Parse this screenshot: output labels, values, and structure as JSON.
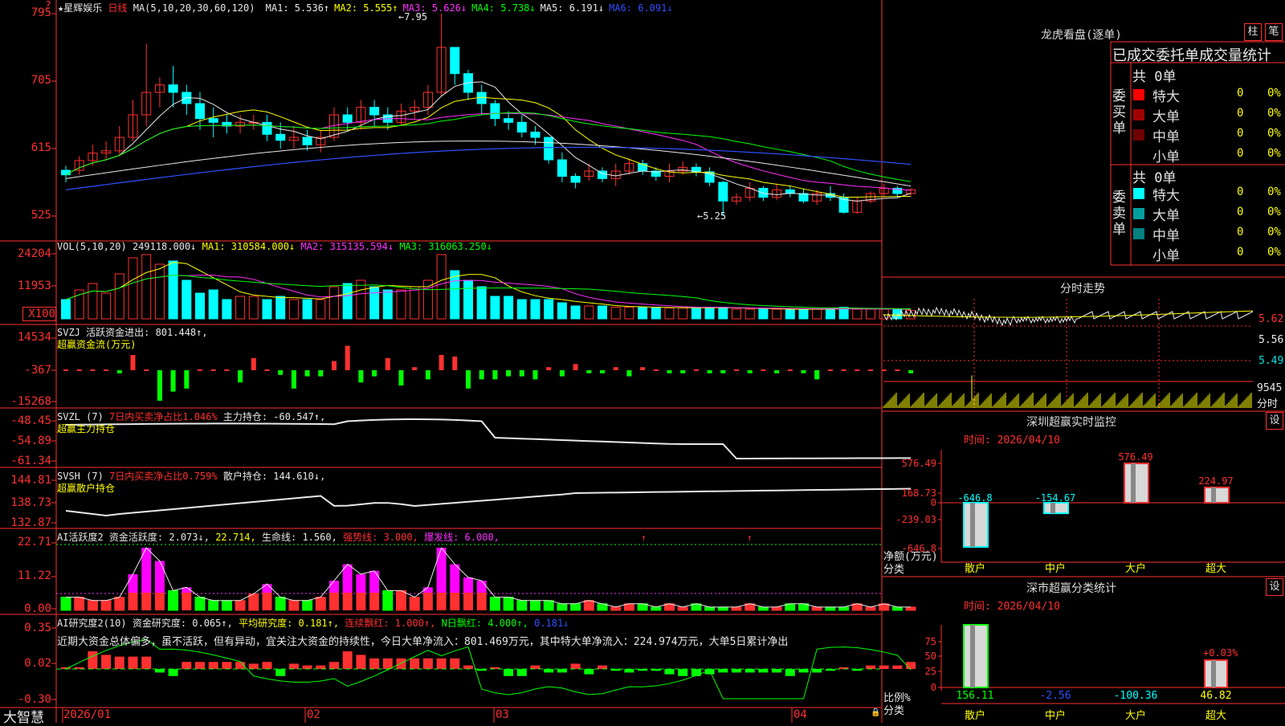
{
  "header": {
    "stock_name": "★星辉娱乐",
    "period": "日线",
    "ma_params": "MA(5,10,20,30,60,120)",
    "ma": [
      {
        "label": "MA1:",
        "value": "5.536↑",
        "color": "#e8e8e8"
      },
      {
        "label": "MA2:",
        "value": "5.555↑",
        "color": "#ffff00"
      },
      {
        "label": "MA3:",
        "value": "5.626↓",
        "color": "#ff30ff"
      },
      {
        "label": "MA4:",
        "value": "5.738↓",
        "color": "#00ff00"
      },
      {
        "label": "MA5:",
        "value": "6.191↓",
        "color": "#e8e8e8"
      },
      {
        "label": "MA6:",
        "value": "6.091↓",
        "color": "#3050ff"
      }
    ],
    "high_mark": "7.95",
    "low_mark": "5.25",
    "corner_mark": "?"
  },
  "price_axis": [
    "795",
    "705",
    "615",
    "525"
  ],
  "vol": {
    "title": "VOL(5,10,20)",
    "value": "249118.000↓",
    "ma1": "MA1: 310584.000↓",
    "ma2": "MA2: 315135.594↓",
    "ma3": "MA3: 316063.250↓",
    "axis": [
      "24204",
      "11953",
      "X100"
    ]
  },
  "svzj": {
    "line1": "SVZJ  活跃资金进出: 801.448↑,",
    "line2": "超赢资金流(万元)",
    "axis": [
      "14534",
      "-367",
      "-15268"
    ]
  },
  "svzl": {
    "title": "SVZL (7)",
    "ratio": "7日内买卖净占比1.046%",
    "hold": "主力持仓: -60.547↑,",
    "line2": "超赢主力持仓",
    "axis": [
      "-48.45",
      "-54.89",
      "-61.34"
    ]
  },
  "svsh": {
    "title": "SVSH (7)",
    "ratio": "7日内买卖净占比0.759%",
    "hold": "散户持仓: 144.610↓,",
    "line2": "超赢散户持仓",
    "axis": [
      "144.81",
      "138.73",
      "132.87"
    ]
  },
  "ai_active": {
    "title": "AI活跃度2",
    "active": "资金活跃度: 2.073↓,",
    "v2": "22.714,",
    "life": "生命线: 1.560,",
    "strong": "强势线: 3.000,",
    "burst": "爆发线: 6.000,",
    "axis": [
      "22.71",
      "11.22",
      "0.00"
    ]
  },
  "ai_research": {
    "title": "AI研究度2(10)",
    "research": "资金研究度: 0.065↑,",
    "avg": "平均研究度: 0.181↑,",
    "cont": "连续飘红: 1.000↑,",
    "nday": "N日飘红: 4.000↑,",
    "v5": "0.181↓",
    "comment": "近期大资金总体偏多，虽不活跃，但有异动，宜关注大资金的持续性，今日大单净流入：801.469万元，其中特大单净流入：224.974万元，大单5日累计净出",
    "axis": [
      "0.35",
      "0.02",
      "-0.30"
    ]
  },
  "bottom": {
    "brand": "大智慧",
    "months": [
      "2026/01",
      "02",
      "03",
      "04"
    ]
  },
  "longhu": {
    "title": "龙虎看盘(逐单)",
    "btn1": "柱",
    "btn2": "笔",
    "heading": "已成交委托单成交量统计",
    "buy_side": "委买单",
    "sell_side": "委卖单",
    "buy_total": "共 0单",
    "sell_total": "共 0单",
    "buy_rows": [
      {
        "name": "特大",
        "count": "0",
        "pct": "0%",
        "color": "#ff0000"
      },
      {
        "name": "大单",
        "count": "0",
        "pct": "0%",
        "color": "#a00000"
      },
      {
        "name": "中单",
        "count": "0",
        "pct": "0%",
        "color": "#700000"
      },
      {
        "name": "小单",
        "count": "0",
        "pct": "0%",
        "color": ""
      }
    ],
    "sell_rows": [
      {
        "name": "特大",
        "count": "0",
        "pct": "0%",
        "color": "#00ffff"
      },
      {
        "name": "大单",
        "count": "0",
        "pct": "0%",
        "color": "#00a0a0"
      },
      {
        "name": "中单",
        "count": "0",
        "pct": "0%",
        "color": "#008080"
      },
      {
        "name": "小单",
        "count": "0",
        "pct": "0%",
        "color": ""
      }
    ]
  },
  "fenshi": {
    "title": "分时走势",
    "axis": [
      "5.62",
      "5.56",
      "5.49"
    ],
    "vol_axis": [
      "9545",
      "分时"
    ]
  },
  "monitor": {
    "title": "深圳超赢实时监控",
    "btn": "设",
    "time": "时间: 2026/04/10",
    "axis": [
      "576.49",
      "168.73",
      "0",
      "-239.03",
      "-646.8"
    ],
    "ylabel": "净额(万元)",
    "xlabel": "分类",
    "categories": [
      "散户",
      "中户",
      "大户",
      "超大"
    ],
    "values": [
      -646.8,
      -154.67,
      576.49,
      224.97
    ],
    "value_labels": [
      "-646.8",
      "-154.67",
      "576.49",
      "224.97"
    ]
  },
  "classify": {
    "title": "深市超赢分类统计",
    "btn": "设",
    "time": "时间: 2026/04/10",
    "axis": [
      "75",
      "50",
      "25",
      "0"
    ],
    "ylabel": "比例%",
    "xlabel": "分类",
    "categories": [
      "散户",
      "中户",
      "大户",
      "超大"
    ],
    "values": [
      156.11,
      -2.56,
      -100.36,
      46.82
    ],
    "value_labels": [
      "156.11",
      "-2.56",
      "-100.36",
      "46.82"
    ],
    "pct_label": "+0.03%"
  },
  "chart_data": {
    "type": "candlestick",
    "title": "星辉娱乐 日线",
    "ylim": [
      5.0,
      8.0
    ],
    "candles": [
      [
        5.86,
        5.8,
        5.92,
        5.7
      ],
      [
        5.86,
        5.99,
        6.05,
        5.8
      ],
      [
        5.99,
        6.09,
        6.2,
        5.92
      ],
      [
        6.09,
        6.12,
        6.25,
        6.0
      ],
      [
        6.12,
        6.3,
        6.45,
        6.05
      ],
      [
        6.3,
        6.6,
        6.8,
        6.25
      ],
      [
        6.6,
        6.9,
        7.55,
        6.45
      ],
      [
        6.9,
        7.0,
        7.1,
        6.7
      ],
      [
        7.0,
        6.9,
        7.25,
        6.7
      ],
      [
        6.9,
        6.75,
        7.0,
        6.6
      ],
      [
        6.75,
        6.55,
        6.9,
        6.4
      ],
      [
        6.55,
        6.5,
        6.7,
        6.3
      ],
      [
        6.5,
        6.45,
        6.6,
        6.35
      ],
      [
        6.45,
        6.5,
        6.6,
        6.35
      ],
      [
        6.5,
        6.5,
        6.6,
        6.4
      ],
      [
        6.5,
        6.34,
        6.6,
        6.25
      ],
      [
        6.34,
        6.26,
        6.5,
        6.15
      ],
      [
        6.26,
        6.3,
        6.45,
        6.15
      ],
      [
        6.3,
        6.2,
        6.4,
        6.12
      ],
      [
        6.2,
        6.3,
        6.4,
        6.1
      ],
      [
        6.3,
        6.6,
        6.7,
        6.25
      ],
      [
        6.6,
        6.5,
        6.7,
        6.4
      ],
      [
        6.5,
        6.7,
        6.8,
        6.4
      ],
      [
        6.7,
        6.6,
        6.8,
        6.45
      ],
      [
        6.6,
        6.5,
        6.7,
        6.4
      ],
      [
        6.5,
        6.65,
        6.75,
        6.45
      ],
      [
        6.65,
        6.7,
        6.8,
        6.55
      ],
      [
        6.7,
        6.9,
        7.0,
        6.6
      ],
      [
        6.9,
        7.5,
        7.95,
        6.85
      ],
      [
        7.5,
        7.15,
        7.5,
        7.0
      ],
      [
        7.15,
        6.9,
        7.2,
        6.8
      ],
      [
        6.9,
        6.75,
        7.0,
        6.6
      ],
      [
        6.75,
        6.55,
        6.8,
        6.45
      ],
      [
        6.55,
        6.5,
        6.65,
        6.4
      ],
      [
        6.5,
        6.37,
        6.6,
        6.3
      ],
      [
        6.37,
        6.3,
        6.45,
        6.2
      ],
      [
        6.3,
        6.0,
        6.3,
        5.95
      ],
      [
        6.0,
        5.78,
        6.1,
        5.7
      ],
      [
        5.78,
        5.7,
        5.82,
        5.62
      ],
      [
        5.78,
        5.85,
        5.95,
        5.72
      ],
      [
        5.85,
        5.75,
        5.9,
        5.7
      ],
      [
        5.75,
        5.85,
        5.95,
        5.65
      ],
      [
        5.85,
        5.95,
        6.02,
        5.8
      ],
      [
        5.95,
        5.85,
        6.0,
        5.8
      ],
      [
        5.85,
        5.78,
        5.9,
        5.72
      ],
      [
        5.78,
        5.85,
        5.95,
        5.7
      ],
      [
        5.85,
        5.9,
        5.98,
        5.8
      ],
      [
        5.9,
        5.84,
        5.95,
        5.78
      ],
      [
        5.84,
        5.7,
        5.9,
        5.65
      ],
      [
        5.7,
        5.45,
        5.72,
        5.25
      ],
      [
        5.45,
        5.5,
        5.55,
        5.4
      ],
      [
        5.5,
        5.62,
        5.7,
        5.45
      ],
      [
        5.62,
        5.5,
        5.65,
        5.45
      ],
      [
        5.5,
        5.6,
        5.68,
        5.46
      ],
      [
        5.6,
        5.55,
        5.65,
        5.5
      ],
      [
        5.55,
        5.45,
        5.62,
        5.42
      ],
      [
        5.45,
        5.55,
        5.6,
        5.4
      ],
      [
        5.55,
        5.5,
        5.65,
        5.45
      ],
      [
        5.5,
        5.3,
        5.55,
        5.28
      ],
      [
        5.3,
        5.45,
        5.5,
        5.28
      ],
      [
        5.45,
        5.55,
        5.58,
        5.42
      ],
      [
        5.55,
        5.62,
        5.68,
        5.5
      ],
      [
        5.62,
        5.55,
        5.65,
        5.5
      ],
      [
        5.55,
        5.6,
        5.62,
        5.52
      ]
    ]
  }
}
